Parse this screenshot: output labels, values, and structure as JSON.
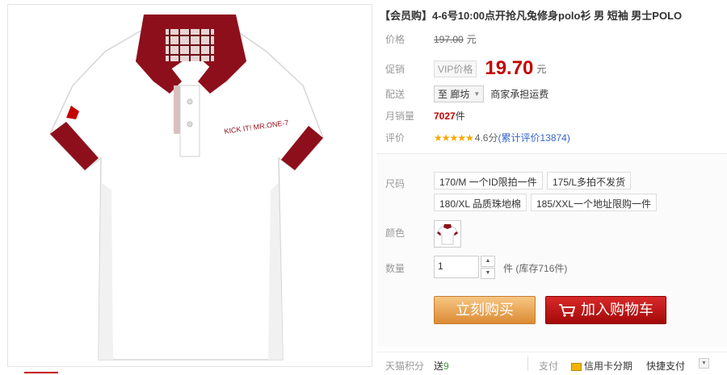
{
  "product": {
    "title": "【会员购】4-6号10:00点开抢凡兔修身polo衫 男 短袖 男士POLO",
    "shirt_logo_text": "KICK IT! MR.ONE-7"
  },
  "price": {
    "label": "价格",
    "original": "197.00",
    "unit": "元"
  },
  "promo": {
    "label": "促销",
    "tag": "VIP价格",
    "price": "19.70",
    "unit": "元"
  },
  "shipping": {
    "label": "配送",
    "location": "至 廊坊",
    "note": "商家承担运费"
  },
  "sales": {
    "label": "月销量",
    "count": "7027",
    "unit": "件"
  },
  "rating": {
    "label": "评价",
    "stars": "★★★★★",
    "score": "4.6分",
    "reviews_link": "(累计评价13874)"
  },
  "options": {
    "size_label": "尺码",
    "sizes": [
      "170/M 一个ID限拍一件",
      "175/L多拍不发货",
      "180/XL 品质珠地棉",
      "185/XXL一个地址限购一件"
    ],
    "color_label": "颜色",
    "qty_label": "数量",
    "qty_value": "1",
    "qty_unit": "件",
    "stock": "(库存716件)",
    "buy_now": "立刻购买",
    "add_cart": "加入购物车"
  },
  "footer": {
    "points_label": "天猫积分",
    "points_send": "送",
    "points_value": "9",
    "pay_label": "支付",
    "credit_card": "信用卡分期",
    "quick_pay": "快捷支付"
  },
  "colors": {
    "accent_red": "#c40000",
    "buy_orange": "#dc8b33",
    "cart_red": "#a30808",
    "collar_red": "#8e0f1c"
  }
}
